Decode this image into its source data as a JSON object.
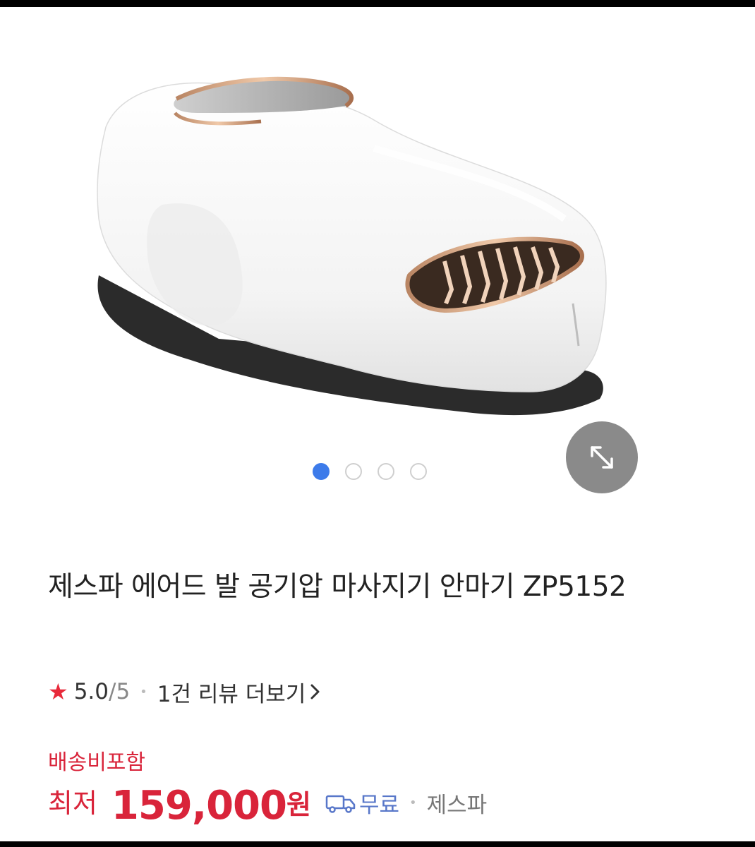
{
  "gallery": {
    "image_alt": "제스파 에어드 발 공기압 마사지기",
    "slide_count": 4,
    "active_slide": 1
  },
  "product": {
    "title": "제스파 에어드 발 공기압 마사지기 안마기 ZP5152"
  },
  "rating": {
    "score": "5.0",
    "max": "/5",
    "review_link": "1건 리뷰 더보기"
  },
  "pricing": {
    "shipping_note": "배송비포함",
    "label": "최저",
    "amount": "159,000",
    "unit": "원",
    "delivery": "무료",
    "seller": "제스파"
  },
  "colors": {
    "accent_red": "#d9243a",
    "active_dot": "#3d7bea",
    "free_shipping_blue": "#5877c9"
  }
}
